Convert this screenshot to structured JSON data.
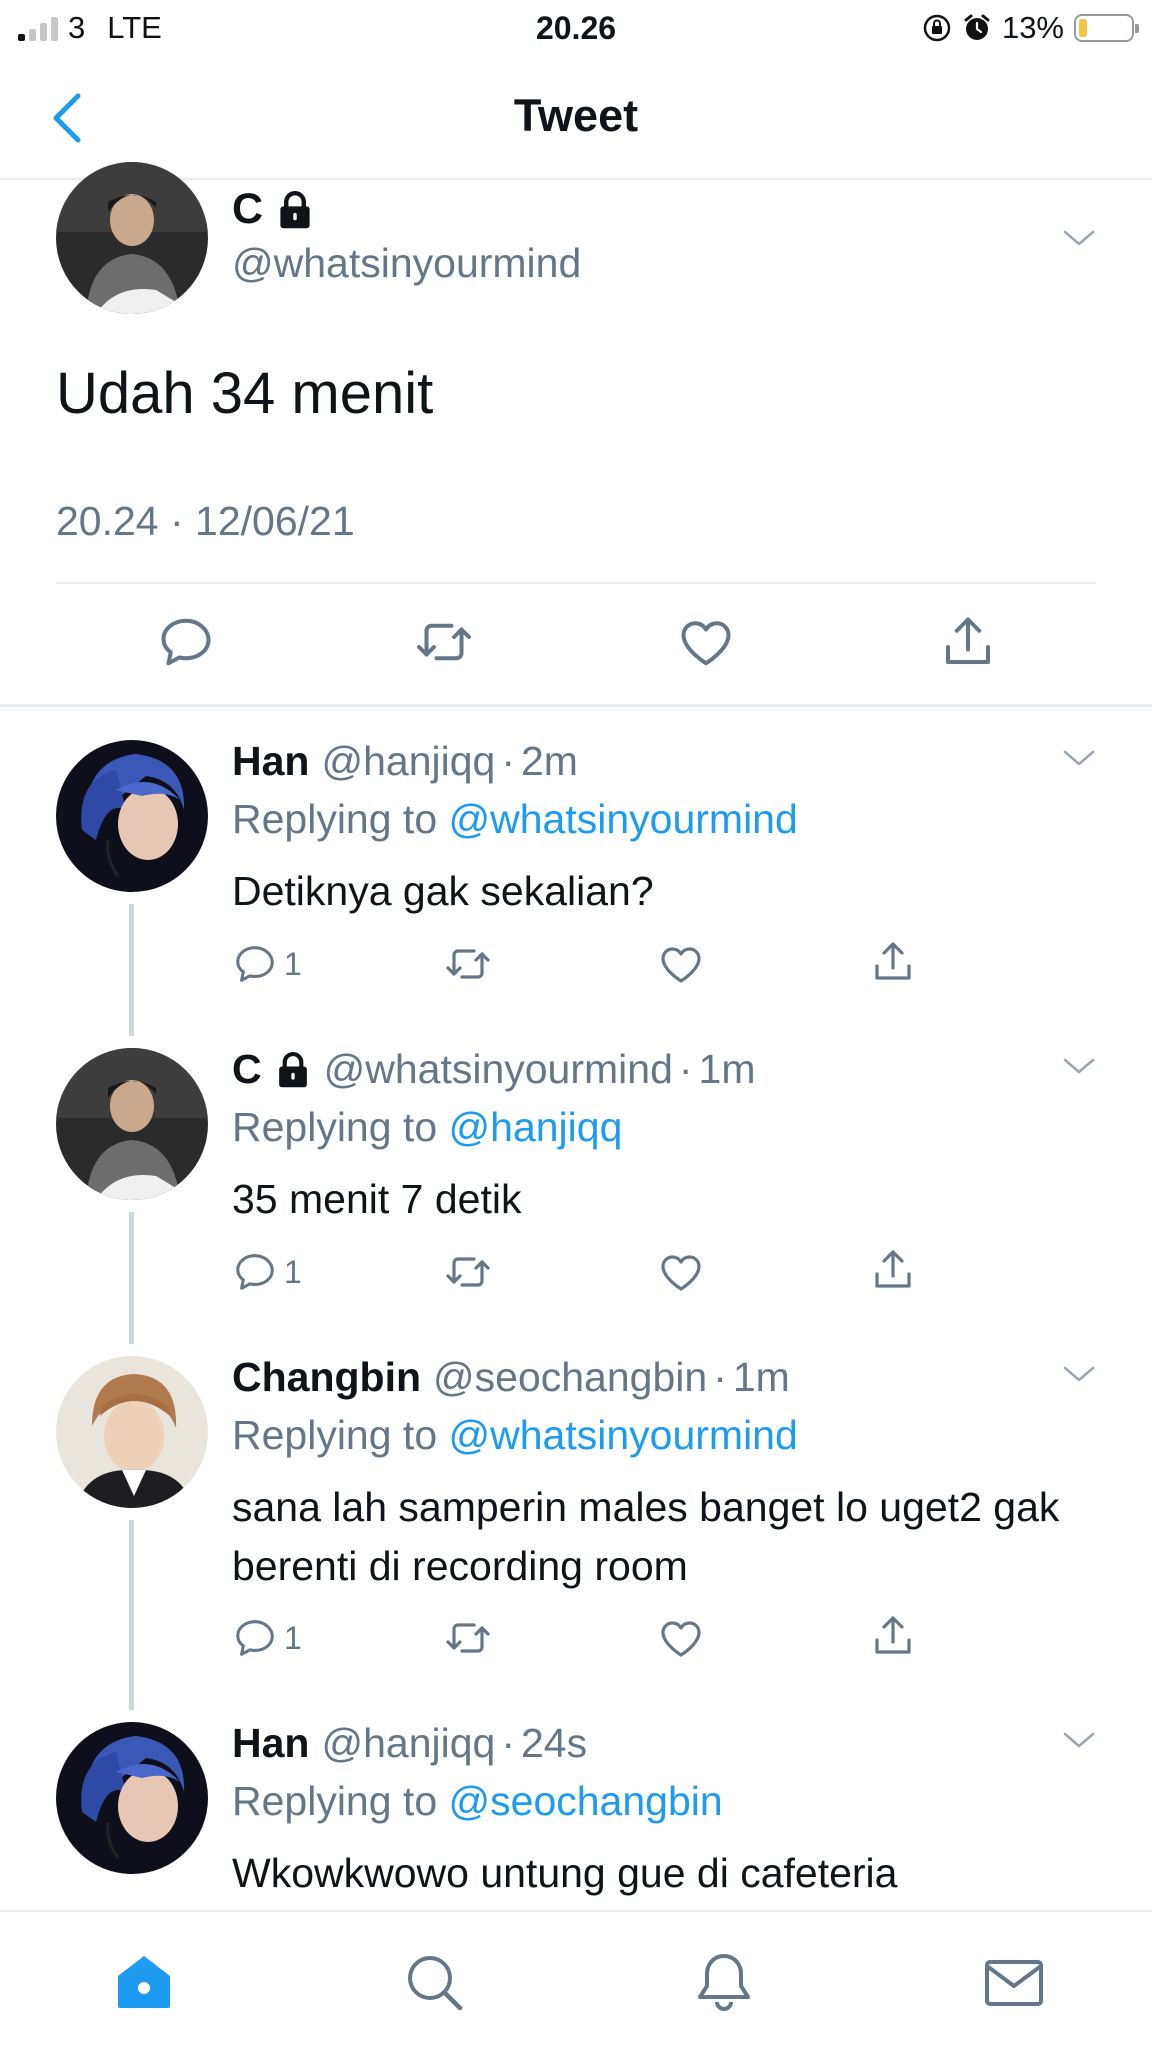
{
  "status": {
    "carrier": "3",
    "network": "LTE",
    "time": "20.26",
    "battery": "13%"
  },
  "nav": {
    "title": "Tweet"
  },
  "main": {
    "name": "C",
    "handle": "@whatsinyourmind",
    "text": "Udah 34 menit",
    "date": "20.24 · 12/06/21"
  },
  "replies": [
    {
      "name": "Han",
      "handle": "@hanjiqq",
      "ago": "2m",
      "replying_prefix": "Replying to ",
      "replying_to": "@whatsinyourmind",
      "text": "Detiknya gak sekalian?",
      "reply_count": "1"
    },
    {
      "name": "C",
      "handle": "@whatsinyourmind",
      "ago": "1m",
      "replying_prefix": "Replying to ",
      "replying_to": "@hanjiqq",
      "text": "35 menit 7 detik",
      "reply_count": "1"
    },
    {
      "name": "Changbin",
      "handle": "@seochangbin",
      "ago": "1m",
      "replying_prefix": "Replying to ",
      "replying_to": "@whatsinyourmind",
      "text": "sana lah samperin males banget lo uget2 gak berenti di recording room",
      "reply_count": "1"
    },
    {
      "name": "Han",
      "handle": "@hanjiqq",
      "ago": "24s",
      "replying_prefix": "Replying to ",
      "replying_to": "@seochangbin",
      "text": "Wkowkwowo untung gue di cafeteria"
    }
  ],
  "colors": {
    "accent": "#1d9bf0",
    "secondary_text": "#657786",
    "divider": "#e6ecf0"
  },
  "icons": [
    "back-icon",
    "lock-icon",
    "chevron-down-icon",
    "reply-icon",
    "retweet-icon",
    "like-icon",
    "share-icon",
    "home-icon",
    "search-icon",
    "bell-icon",
    "mail-icon"
  ]
}
